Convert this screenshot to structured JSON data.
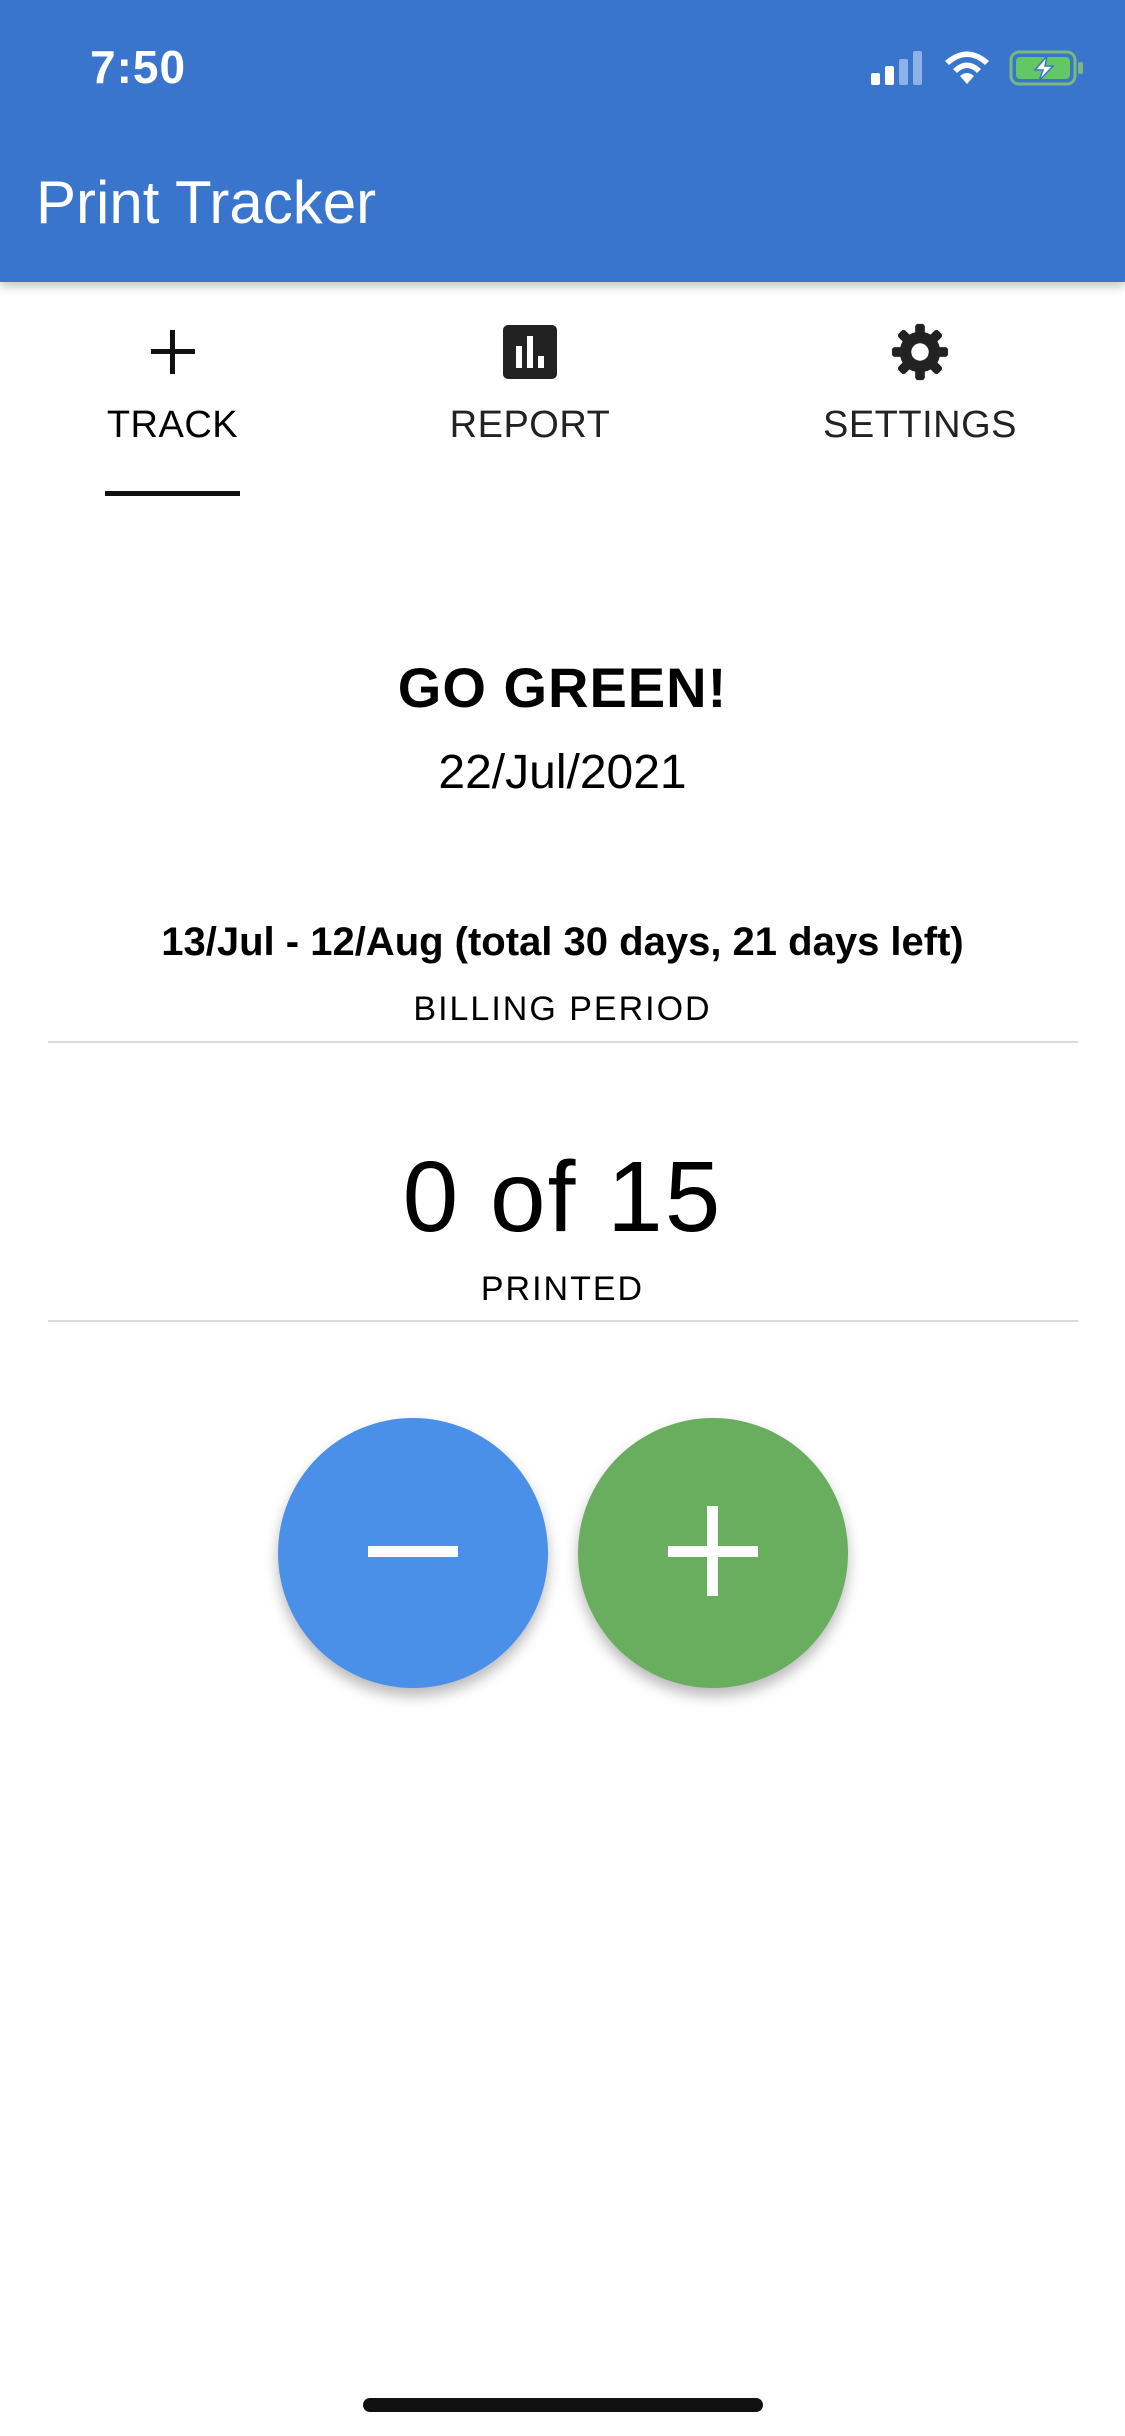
{
  "status_bar": {
    "time": "7:50",
    "icons": [
      "cellular-signal-icon",
      "wifi-icon",
      "battery-charging-icon"
    ]
  },
  "app_bar": {
    "title": "Print Tracker",
    "color": "#3a75cd"
  },
  "tabs": [
    {
      "label": "TRACK",
      "icon": "plus-icon",
      "active": true
    },
    {
      "label": "REPORT",
      "icon": "bar-chart-icon",
      "active": false
    },
    {
      "label": "SETTINGS",
      "icon": "gear-icon",
      "active": false
    }
  ],
  "track": {
    "tagline": "GO GREEN!",
    "date": "22/Jul/2021",
    "billing_period": {
      "value": "13/Jul - 12/Aug (total 30 days, 21 days left)",
      "label": "BILLING PERIOD"
    },
    "printed": {
      "value": "0 of 15",
      "label": "PRINTED"
    },
    "decrement_button": {
      "icon": "minus-icon",
      "color": "#4a90e8"
    },
    "increment_button": {
      "icon": "plus-icon",
      "color": "#69ad5e"
    }
  }
}
